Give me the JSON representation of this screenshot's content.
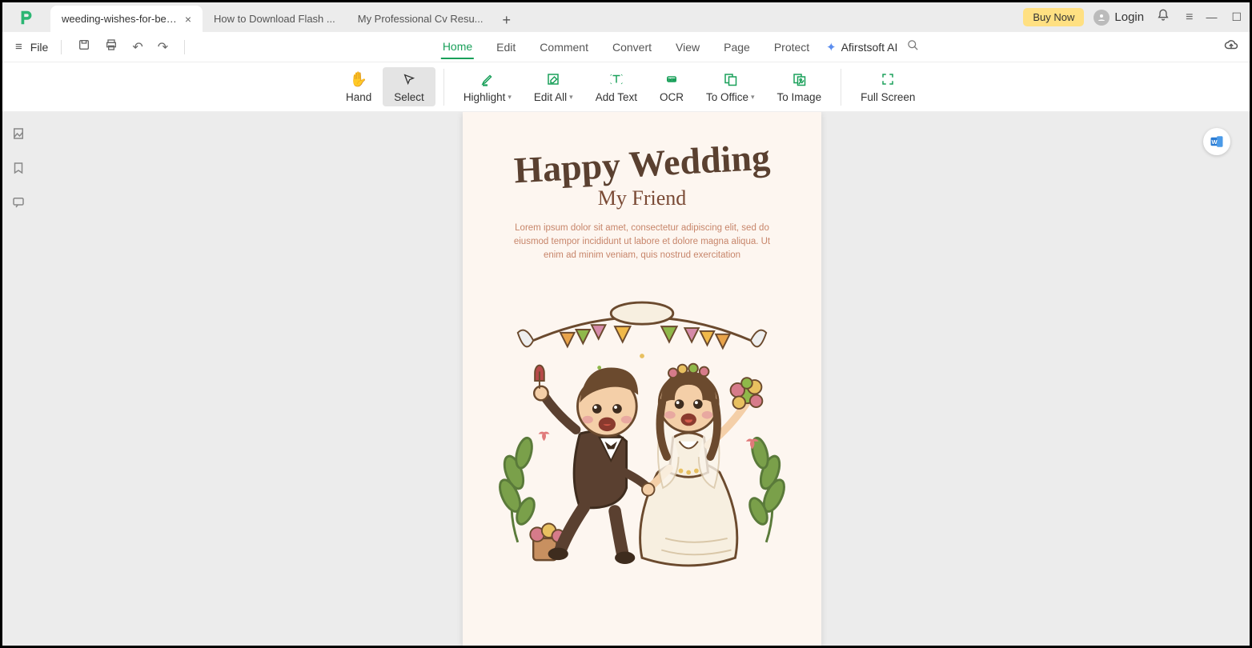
{
  "titlebar": {
    "tabs": [
      {
        "label": "weeding-wishes-for-bes...",
        "active": true
      },
      {
        "label": "How to Download Flash ...",
        "active": false
      },
      {
        "label": "My Professional Cv Resu...",
        "active": false
      }
    ],
    "buy_now": "Buy Now",
    "login": "Login"
  },
  "toolbar1": {
    "file": "File"
  },
  "menu": {
    "items": [
      "Home",
      "Edit",
      "Comment",
      "Convert",
      "View",
      "Page",
      "Protect"
    ],
    "active": "Home",
    "ai_label": "Afirstsoft AI"
  },
  "ribbon": {
    "hand": "Hand",
    "select": "Select",
    "highlight": "Highlight",
    "edit_all": "Edit All",
    "add_text": "Add Text",
    "ocr": "OCR",
    "to_office": "To Office",
    "to_image": "To Image",
    "full_screen": "Full Screen"
  },
  "document": {
    "title": "Happy Wedding",
    "subtitle": "My Friend",
    "body": "Lorem ipsum dolor sit amet, consectetur adipiscing elit, sed do eiusmod tempor incididunt ut labore et dolore magna aliqua. Ut enim ad minim veniam, quis nostrud exercitation"
  }
}
